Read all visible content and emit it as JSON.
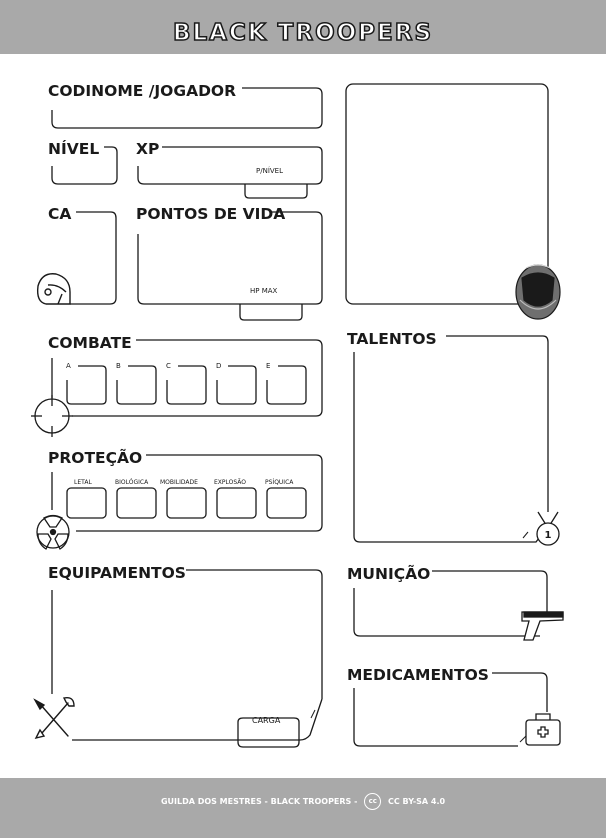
{
  "header": {
    "title": "BLACK TROOPERS"
  },
  "fields": {
    "codinome": "CODINOME /JOGADOR",
    "nivel": "NÍVEL",
    "xp": "XP",
    "xp_per_level": "P/NÍVEL",
    "ca": "CA",
    "pontos_de_vida": "PONTOS DE VIDA",
    "hp_max": "HP MAX",
    "combate": "COMBATE",
    "combate_slots": [
      "A",
      "B",
      "C",
      "D",
      "E"
    ],
    "protecao": "PROTEÇÃO",
    "protecao_slots": [
      "LETAL",
      "BIOLÓGICA",
      "MOBILIDADE",
      "EXPLOSÃO",
      "PSÍQUICA"
    ],
    "equipamentos": "EQUIPAMENTOS",
    "carga": "CARGA",
    "talentos": "TALENTOS",
    "municao": "MUNIÇÃO",
    "medicamentos": "MEDICAMENTOS"
  },
  "medal_number": "1",
  "footer": {
    "credit": "GUILDA DOS MESTRES - BLACK TROOPERS -",
    "cc_icon_text": "cc",
    "license": "CC BY-SA 4.0"
  },
  "icons": [
    "helmet-icon",
    "crosshair-icon",
    "radiation-icon",
    "tools-icon",
    "medal-icon",
    "pistol-icon",
    "medkit-icon",
    "soldier-helmet-icon"
  ],
  "colors": {
    "band": "#a9a9a9",
    "ink": "#1a1a1a",
    "paper": "#ffffff"
  }
}
